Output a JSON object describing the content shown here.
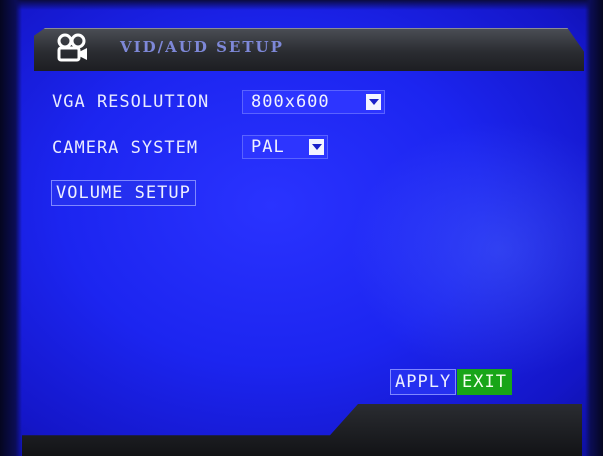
{
  "window": {
    "title": "VID/AUD SETUP",
    "icon": "camera-icon"
  },
  "settings": {
    "vga_resolution": {
      "label": "VGA RESOLUTION",
      "value": "800x600"
    },
    "camera_system": {
      "label": "CAMERA SYSTEM",
      "value": "PAL"
    }
  },
  "buttons": {
    "volume_setup": "VOLUME SETUP",
    "apply": "APPLY",
    "exit": "EXIT"
  },
  "colors": {
    "background": "#1c25f0",
    "exit_button": "#18a518",
    "titlebar": "#2a2c31"
  }
}
